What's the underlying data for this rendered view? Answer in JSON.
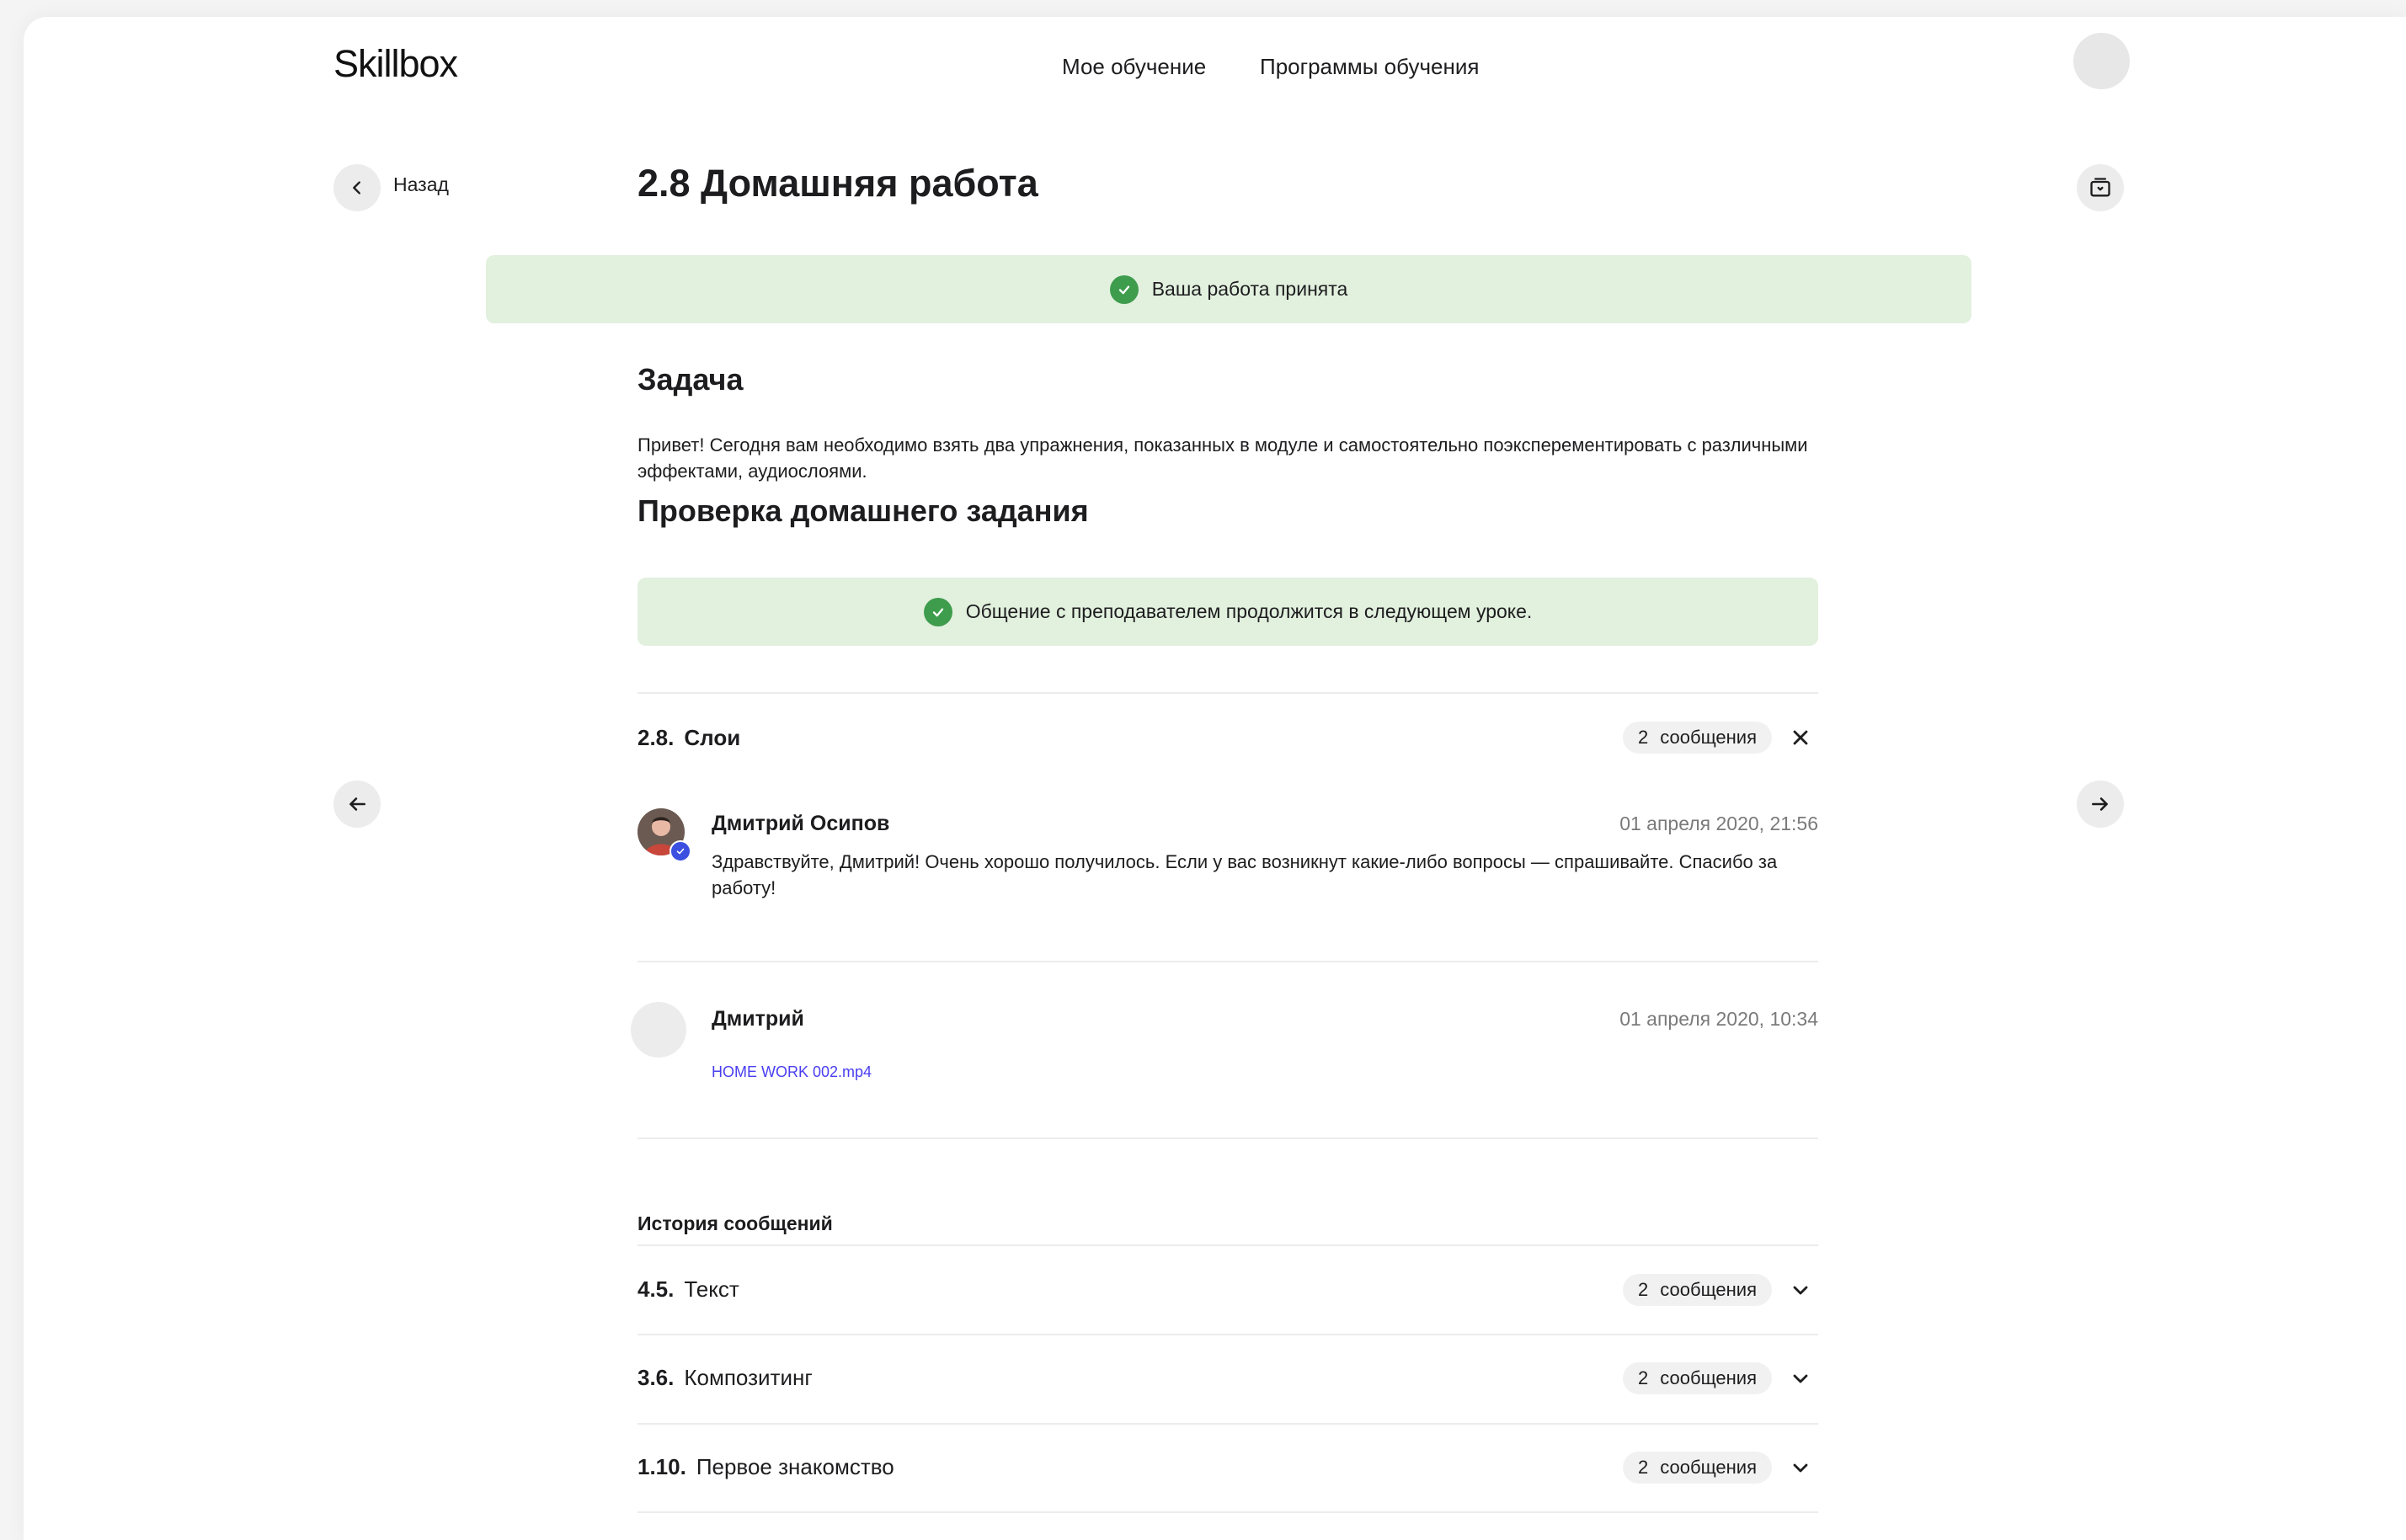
{
  "header": {
    "logo": "Skillbox",
    "nav": [
      "Мое обучение",
      "Программы обучения"
    ]
  },
  "title_row": {
    "back_label": "Назад",
    "title": "2.8 Домашняя работа"
  },
  "accepted_banner": {
    "text": "Ваша работа принята"
  },
  "task": {
    "heading": "Задача",
    "text": "Привет! Сегодня вам необходимо взять два упражнения, показанных в модуле и самостоятельно поэксперементировать с различными эффектами, аудиослоями."
  },
  "review": {
    "heading": "Проверка домашнего задания",
    "banner": "Общение с преподавателем продолжится в следующем уроке."
  },
  "current_thread": {
    "number": "2.8.",
    "name": "Слои",
    "count": "2",
    "count_label": "сообщения",
    "messages": [
      {
        "author": "Дмитрий Осипов",
        "date": "01 апреля 2020, 21:56",
        "text": "Здравствуйте, Дмитрий! Очень хорошо получилось. Если у вас возникнут какие-либо вопросы — спрашивайте. Спасибо за работу!"
      },
      {
        "author": "Дмитрий",
        "date": "01 апреля 2020, 10:34",
        "file": "HOME WORK 002.mp4"
      }
    ]
  },
  "history": {
    "label": "История сообщений",
    "items": [
      {
        "number": "4.5.",
        "name": "Текст",
        "count": "2",
        "count_label": "сообщения"
      },
      {
        "number": "3.6.",
        "name": "Композитинг",
        "count": "2",
        "count_label": "сообщения"
      },
      {
        "number": "1.10.",
        "name": "Первое знакомство",
        "count": "2",
        "count_label": "сообщения"
      }
    ]
  },
  "colors": {
    "banner_bg": "#e2f0de",
    "check_green": "#3e9c4d",
    "link": "#4a3ef0"
  },
  "icons": [
    "chevron-left-icon",
    "archive-icon",
    "check-icon",
    "close-icon",
    "arrow-left-icon",
    "arrow-right-icon",
    "chevron-down-icon",
    "verified-icon"
  ]
}
